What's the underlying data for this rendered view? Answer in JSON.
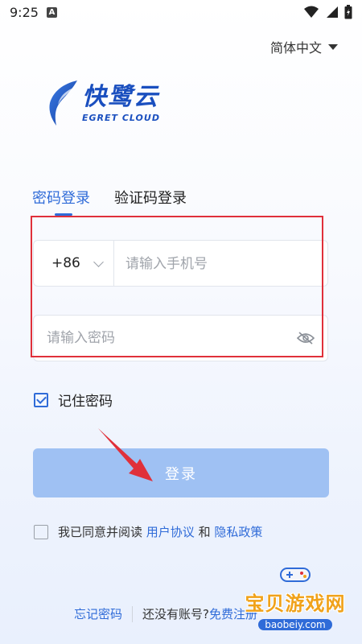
{
  "status_bar": {
    "time": "9:25",
    "notification_icon": "a-notification-icon"
  },
  "language": {
    "label": "简体中文"
  },
  "logo": {
    "name_cn": "快鹭云",
    "name_en": "EGRET CLOUD"
  },
  "tabs": [
    {
      "label": "密码登录",
      "active": true
    },
    {
      "label": "验证码登录",
      "active": false
    }
  ],
  "phone": {
    "country_code": "+86",
    "placeholder": "请输入手机号"
  },
  "password": {
    "placeholder": "请输入密码"
  },
  "remember": {
    "label": "记住密码",
    "checked": true
  },
  "login_button": {
    "label": "登录"
  },
  "agreement": {
    "prefix": "我已同意并阅读",
    "user_agreement": "用户协议",
    "and": "和",
    "privacy_policy": "隐私政策",
    "checked": false
  },
  "bottom": {
    "forgot_password": "忘记密码",
    "no_account": "还没有账号?",
    "register": "免费注册"
  },
  "watermark": {
    "title": "宝贝游戏网",
    "url": "baobeiy.com"
  },
  "colors": {
    "accent": "#2f6bd8",
    "button_disabled": "#9fc1f3",
    "annotation_red": "#e0303a"
  }
}
